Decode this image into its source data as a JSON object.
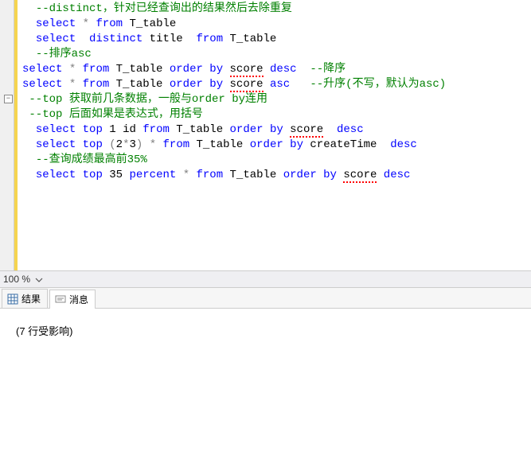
{
  "code": {
    "lines": [
      {
        "indent": 2,
        "tokens": [
          {
            "t": "--distinct，针对已经查询出的结果然后去除重复",
            "c": "cm"
          }
        ]
      },
      {
        "indent": 2,
        "tokens": [
          {
            "t": "select",
            "c": "kw"
          },
          {
            "t": " "
          },
          {
            "t": "*",
            "c": "op"
          },
          {
            "t": " "
          },
          {
            "t": "from",
            "c": "kw"
          },
          {
            "t": " T_table"
          }
        ]
      },
      {
        "indent": 2,
        "tokens": [
          {
            "t": "select",
            "c": "kw"
          },
          {
            "t": "  "
          },
          {
            "t": "distinct",
            "c": "kw"
          },
          {
            "t": " title  "
          },
          {
            "t": "from",
            "c": "kw"
          },
          {
            "t": " T_table"
          }
        ]
      },
      {
        "indent": 2,
        "tokens": [
          {
            "t": "--排序asc",
            "c": "cm"
          }
        ]
      },
      {
        "indent": 0,
        "tokens": []
      },
      {
        "indent": 0,
        "tokens": [
          {
            "t": "select",
            "c": "kw"
          },
          {
            "t": " "
          },
          {
            "t": "*",
            "c": "op"
          },
          {
            "t": " "
          },
          {
            "t": "from",
            "c": "kw"
          },
          {
            "t": " T_table "
          },
          {
            "t": "order",
            "c": "kw"
          },
          {
            "t": " "
          },
          {
            "t": "by",
            "c": "kw"
          },
          {
            "t": " "
          },
          {
            "t": "score",
            "c": "",
            "sq": true
          },
          {
            "t": " "
          },
          {
            "t": "desc",
            "c": "kw"
          },
          {
            "t": "  "
          },
          {
            "t": "--降序",
            "c": "cm"
          }
        ]
      },
      {
        "indent": 0,
        "fold": true,
        "tokens": [
          {
            "t": "select",
            "c": "kw"
          },
          {
            "t": " "
          },
          {
            "t": "*",
            "c": "op"
          },
          {
            "t": " "
          },
          {
            "t": "from",
            "c": "kw"
          },
          {
            "t": " T_table "
          },
          {
            "t": "order",
            "c": "kw"
          },
          {
            "t": " "
          },
          {
            "t": "by",
            "c": "kw"
          },
          {
            "t": " "
          },
          {
            "t": "score",
            "c": "",
            "sq": true
          },
          {
            "t": " "
          },
          {
            "t": "asc",
            "c": "kw"
          },
          {
            "t": "   "
          },
          {
            "t": "--升序(不写，默认为asc)",
            "c": "cm"
          }
        ]
      },
      {
        "indent": 0,
        "tokens": []
      },
      {
        "indent": 1,
        "tokens": [
          {
            "t": "--top 获取前几条数据，一般与order by连用",
            "c": "cm"
          }
        ]
      },
      {
        "indent": 1,
        "tokens": [
          {
            "t": "--top 后面如果是表达式，用括号",
            "c": "cm"
          }
        ]
      },
      {
        "indent": 2,
        "tokens": [
          {
            "t": "select",
            "c": "kw"
          },
          {
            "t": " "
          },
          {
            "t": "top",
            "c": "kw"
          },
          {
            "t": " 1 id "
          },
          {
            "t": "from",
            "c": "kw"
          },
          {
            "t": " T_table "
          },
          {
            "t": "order",
            "c": "kw"
          },
          {
            "t": " "
          },
          {
            "t": "by",
            "c": "kw"
          },
          {
            "t": " "
          },
          {
            "t": "score",
            "c": "",
            "sq": true
          },
          {
            "t": "  "
          },
          {
            "t": "desc",
            "c": "kw"
          }
        ]
      },
      {
        "indent": 2,
        "tokens": [
          {
            "t": "select",
            "c": "kw"
          },
          {
            "t": " "
          },
          {
            "t": "top",
            "c": "kw"
          },
          {
            "t": " "
          },
          {
            "t": "(",
            "c": "op"
          },
          {
            "t": "2"
          },
          {
            "t": "*",
            "c": "op"
          },
          {
            "t": "3"
          },
          {
            "t": ")",
            "c": "op"
          },
          {
            "t": " "
          },
          {
            "t": "*",
            "c": "op"
          },
          {
            "t": " "
          },
          {
            "t": "from",
            "c": "kw"
          },
          {
            "t": " T_table "
          },
          {
            "t": "order",
            "c": "kw"
          },
          {
            "t": " "
          },
          {
            "t": "by",
            "c": "kw"
          },
          {
            "t": " createTime  "
          },
          {
            "t": "desc",
            "c": "kw"
          }
        ]
      },
      {
        "indent": 2,
        "tokens": [
          {
            "t": "--查询成绩最高前35%",
            "c": "cm"
          }
        ]
      },
      {
        "indent": 2,
        "tokens": [
          {
            "t": "select",
            "c": "kw"
          },
          {
            "t": " "
          },
          {
            "t": "top",
            "c": "kw"
          },
          {
            "t": " 35 "
          },
          {
            "t": "percent",
            "c": "kw"
          },
          {
            "t": " "
          },
          {
            "t": "*",
            "c": "op"
          },
          {
            "t": " "
          },
          {
            "t": "from",
            "c": "kw"
          },
          {
            "t": " T_table "
          },
          {
            "t": "order",
            "c": "kw"
          },
          {
            "t": " "
          },
          {
            "t": "by",
            "c": "kw"
          },
          {
            "t": " "
          },
          {
            "t": "score",
            "c": "",
            "sq": true
          },
          {
            "t": " "
          },
          {
            "t": "desc",
            "c": "kw"
          }
        ]
      }
    ]
  },
  "zoom": {
    "level": "100 %"
  },
  "tabs": {
    "results_label": "结果",
    "messages_label": "消息"
  },
  "messages": {
    "text": "(7 行受影响)"
  },
  "fold_glyph": "−"
}
